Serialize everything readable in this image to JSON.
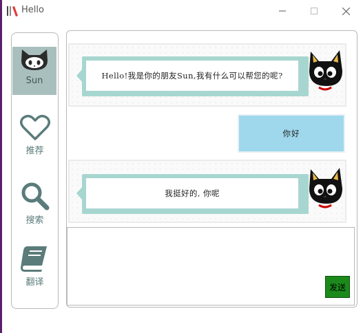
{
  "window": {
    "title": "Hello",
    "minimize_icon": "minimize-icon",
    "maximize_icon": "maximize-icon",
    "close_icon": "close-icon"
  },
  "sidebar": {
    "items": [
      {
        "label": "Sun",
        "icon": "octocat-icon",
        "active": true
      },
      {
        "label": "推荐",
        "icon": "heart-icon",
        "active": false
      },
      {
        "label": "搜索",
        "icon": "search-icon",
        "active": false
      },
      {
        "label": "翻译",
        "icon": "book-icon",
        "active": false
      }
    ]
  },
  "chat": {
    "messages": [
      {
        "from": "bot",
        "text": "Hello!我是你的朋友Sun,我有什么可以帮您的呢?"
      },
      {
        "from": "user",
        "text": "你好"
      },
      {
        "from": "bot",
        "text": "我挺好的, 你呢"
      }
    ]
  },
  "composer": {
    "value": "",
    "send_label": "发送"
  },
  "colors": {
    "accent_teal": "#a7d6d0",
    "sidebar_active": "#a9bfbd",
    "user_bubble": "#9fd8ec",
    "send_button": "#1b8a1b"
  }
}
